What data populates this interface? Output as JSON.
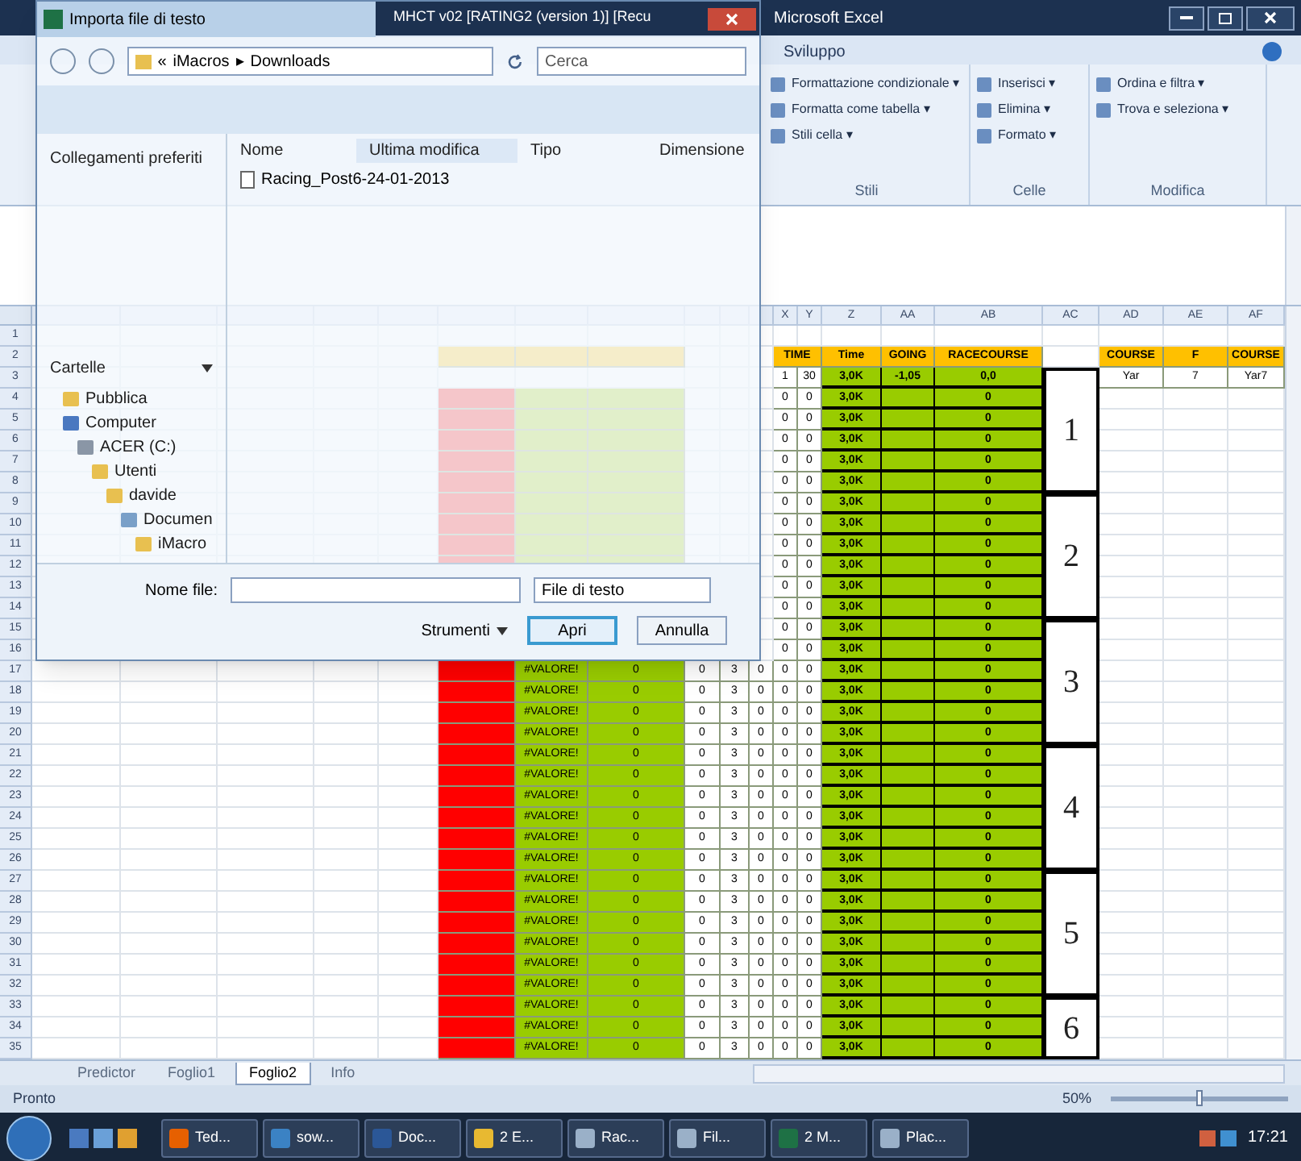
{
  "excel": {
    "title_parts": [
      "MHCT v02 [RATING2 (version 1)] [Recu",
      "Microsoft Excel"
    ],
    "ribbon_tabs": [
      {
        "label": "Sviluppo",
        "selected": false
      }
    ],
    "ribbon_groups": [
      {
        "label": "Stili",
        "items": [
          "Formattazione condizionale ▾",
          "Formatta come tabella ▾",
          "Stili cella ▾"
        ]
      },
      {
        "label": "Celle",
        "items": [
          "Inserisci ▾",
          "Elimina ▾",
          "Formato ▾"
        ]
      },
      {
        "label": "Modifica",
        "items": [
          "Ordina e filtra ▾",
          "Trova e seleziona ▾"
        ]
      }
    ],
    "sheet": {
      "columns": [
        "X",
        "Y",
        "Z",
        "AA",
        "AB",
        "AC",
        "AD",
        "AE",
        "AF"
      ],
      "races": [
        "1",
        "2",
        "3",
        "4",
        "5",
        "6"
      ],
      "rows": [
        {
          "number": "1",
          "kind": "blank"
        },
        {
          "number": "2",
          "kind": "header",
          "time_1": "TIME",
          "time": "Time",
          "going": "GOING",
          "racecourse": "RACECOURSE",
          "course": "COURSE",
          "f": "F",
          "course_2": "COURSE"
        },
        {
          "number": "3",
          "kind": "lead",
          "time_1": "1",
          "time_2": "30",
          "time": "3,0K",
          "going": "-1,05",
          "racecourse": "0,0",
          "course": "Yar",
          "f": "7",
          "course_2": "Yar7"
        },
        {
          "number": "4",
          "kind": "data",
          "time_1": "0",
          "time_2": "0",
          "time": "3,0K",
          "racecourse": "0"
        },
        {
          "number": "5",
          "kind": "data",
          "time_1": "0",
          "time_2": "0",
          "time": "3,0K",
          "racecourse": "0"
        },
        {
          "number": "6",
          "kind": "data",
          "time_1": "0",
          "time_2": "0",
          "time": "3,0K",
          "racecourse": "0"
        },
        {
          "number": "7",
          "kind": "data",
          "time_1": "0",
          "time_2": "0",
          "time": "3,0K",
          "racecourse": "0"
        },
        {
          "number": "8",
          "kind": "data",
          "time_1": "0",
          "time_2": "0",
          "time": "3,0K",
          "racecourse": "0"
        },
        {
          "number": "9",
          "kind": "data",
          "time_1": "0",
          "time_2": "0",
          "time": "3,0K",
          "racecourse": "0"
        },
        {
          "number": "10",
          "kind": "data",
          "time_1": "0",
          "time_2": "0",
          "time": "3,0K",
          "racecourse": "0"
        },
        {
          "number": "11",
          "kind": "data",
          "time_1": "0",
          "time_2": "0",
          "time": "3,0K",
          "racecourse": "0"
        },
        {
          "number": "12",
          "kind": "data",
          "time_1": "0",
          "time_2": "0",
          "time": "3,0K",
          "racecourse": "0"
        },
        {
          "number": "13",
          "kind": "data",
          "time_1": "0",
          "time_2": "0",
          "time": "3,0K",
          "racecourse": "0"
        },
        {
          "number": "14",
          "kind": "data",
          "time_1": "0",
          "time_2": "0",
          "time": "3,0K",
          "racecourse": "0"
        },
        {
          "number": "15",
          "kind": "data",
          "time_1": "0",
          "time_2": "0",
          "time": "3,0K",
          "racecourse": "0"
        },
        {
          "number": "16",
          "kind": "data",
          "time_1": "0",
          "time_2": "0",
          "time": "3,0K",
          "racecourse": "0"
        },
        {
          "number": "17",
          "kind": "data",
          "ottimale": "#VALORE!",
          "yard": "0",
          "col_i": "0",
          "col_j": "3",
          "col_w": "0",
          "time_1": "0",
          "time_2": "0",
          "time": "3,0K",
          "racecourse": "0"
        },
        {
          "number": "18",
          "kind": "data",
          "ottimale": "#VALORE!",
          "yard": "0",
          "col_i": "0",
          "col_j": "3",
          "col_w": "0",
          "time_1": "0",
          "time_2": "0",
          "time": "3,0K",
          "racecourse": "0"
        },
        {
          "number": "19",
          "kind": "data",
          "ottimale": "#VALORE!",
          "yard": "0",
          "col_i": "0",
          "col_j": "3",
          "col_w": "0",
          "time_1": "0",
          "time_2": "0",
          "time": "3,0K",
          "racecourse": "0"
        },
        {
          "number": "20",
          "kind": "data",
          "ottimale": "#VALORE!",
          "yard": "0",
          "col_i": "0",
          "col_j": "3",
          "col_w": "0",
          "time_1": "0",
          "time_2": "0",
          "time": "3,0K",
          "racecourse": "0"
        },
        {
          "number": "21",
          "kind": "data",
          "ottimale": "#VALORE!",
          "yard": "0",
          "col_i": "0",
          "col_j": "3",
          "col_w": "0",
          "time_1": "0",
          "time_2": "0",
          "time": "3,0K",
          "racecourse": "0"
        },
        {
          "number": "22",
          "kind": "data",
          "ottimale": "#VALORE!",
          "yard": "0",
          "col_i": "0",
          "col_j": "3",
          "col_w": "0",
          "time_1": "0",
          "time_2": "0",
          "time": "3,0K",
          "racecourse": "0"
        },
        {
          "number": "23",
          "kind": "data",
          "ottimale": "#VALORE!",
          "yard": "0",
          "col_i": "0",
          "col_j": "3",
          "col_w": "0",
          "time_1": "0",
          "time_2": "0",
          "time": "3,0K",
          "racecourse": "0"
        },
        {
          "number": "24",
          "kind": "data",
          "ottimale": "#VALORE!",
          "yard": "0",
          "col_i": "0",
          "col_j": "3",
          "col_w": "0",
          "time_1": "0",
          "time_2": "0",
          "time": "3,0K",
          "racecourse": "0"
        },
        {
          "number": "25",
          "kind": "data",
          "ottimale": "#VALORE!",
          "yard": "0",
          "col_i": "0",
          "col_j": "3",
          "col_w": "0",
          "time_1": "0",
          "time_2": "0",
          "time": "3,0K",
          "racecourse": "0"
        },
        {
          "number": "26",
          "kind": "data",
          "ottimale": "#VALORE!",
          "yard": "0",
          "col_i": "0",
          "col_j": "3",
          "col_w": "0",
          "time_1": "0",
          "time_2": "0",
          "time": "3,0K",
          "racecourse": "0"
        },
        {
          "number": "27",
          "kind": "data",
          "ottimale": "#VALORE!",
          "yard": "0",
          "col_i": "0",
          "col_j": "3",
          "col_w": "0",
          "time_1": "0",
          "time_2": "0",
          "time": "3,0K",
          "racecourse": "0"
        },
        {
          "number": "28",
          "kind": "data",
          "ottimale": "#VALORE!",
          "yard": "0",
          "col_i": "0",
          "col_j": "3",
          "col_w": "0",
          "time_1": "0",
          "time_2": "0",
          "time": "3,0K",
          "racecourse": "0"
        },
        {
          "number": "29",
          "kind": "data",
          "ottimale": "#VALORE!",
          "yard": "0",
          "col_i": "0",
          "col_j": "3",
          "col_w": "0",
          "time_1": "0",
          "time_2": "0",
          "time": "3,0K",
          "racecourse": "0"
        },
        {
          "number": "30",
          "kind": "data",
          "ottimale": "#VALORE!",
          "yard": "0",
          "col_i": "0",
          "col_j": "3",
          "col_w": "0",
          "time_1": "0",
          "time_2": "0",
          "time": "3,0K",
          "racecourse": "0"
        },
        {
          "number": "31",
          "kind": "data",
          "ottimale": "#VALORE!",
          "yard": "0",
          "col_i": "0",
          "col_j": "3",
          "col_w": "0",
          "time_1": "0",
          "time_2": "0",
          "time": "3,0K",
          "racecourse": "0"
        },
        {
          "number": "32",
          "kind": "data",
          "ottimale": "#VALORE!",
          "yard": "0",
          "col_i": "0",
          "col_j": "3",
          "col_w": "0",
          "time_1": "0",
          "time_2": "0",
          "time": "3,0K",
          "racecourse": "0"
        },
        {
          "number": "33",
          "kind": "data",
          "ottimale": "#VALORE!",
          "yard": "0",
          "col_i": "0",
          "col_j": "3",
          "col_w": "0",
          "time_1": "0",
          "time_2": "0",
          "time": "3,0K",
          "racecourse": "0"
        },
        {
          "number": "34",
          "kind": "data",
          "ottimale": "#VALORE!",
          "yard": "0",
          "col_i": "0",
          "col_j": "3",
          "col_w": "0",
          "time_1": "0",
          "time_2": "0",
          "time": "3,0K",
          "racecourse": "0"
        },
        {
          "number": "35",
          "kind": "data",
          "ottimale": "#VALORE!",
          "yard": "0",
          "col_i": "0",
          "col_j": "3",
          "col_w": "0",
          "time_1": "0",
          "time_2": "0",
          "time": "3,0K",
          "racecourse": "0"
        }
      ]
    },
    "sheet_tabs": [
      {
        "label": "Predictor",
        "selected": false
      },
      {
        "label": "Foglio1",
        "selected": false
      },
      {
        "label": "Foglio2",
        "selected": true
      },
      {
        "label": "Info",
        "selected": false
      }
    ],
    "status": "Pronto",
    "zoom": "50%",
    "zoom_slider": {
      "level": 0.5
    }
  },
  "dialog": {
    "title": "Importa file di testo",
    "address": [
      "«",
      "iMacros",
      "▸",
      "Downloads"
    ],
    "search": {
      "placeholder": "Cerca"
    },
    "favorites": "Collegamenti preferiti",
    "folders": "Cartelle",
    "tree": [
      {
        "label": "Pubblica",
        "kind": "folder"
      },
      {
        "label": "Computer",
        "kind": "computer",
        "children": [
          {
            "label": "ACER (C:)",
            "kind": "drive",
            "children": [
              {
                "label": "Utenti",
                "kind": "folder",
                "children": [
                  {
                    "label": "davide",
                    "kind": "folder",
                    "children": [
                      {
                        "label": "Documen",
                        "kind": "library",
                        "children": [
                          {
                            "label": "iMacro",
                            "kind": "folder"
                          }
                        ]
                      }
                    ]
                  }
                ]
              }
            ]
          }
        ]
      }
    ],
    "list_columns": [
      "Nome",
      "Ultima modifica",
      "Tipo",
      "Dimensione"
    ],
    "files": [
      "Racing_Post6-24-01-2013"
    ],
    "file_name_label": "Nome file:",
    "file_type": "File di testo",
    "tools": "Strumenti",
    "open": "Apri",
    "cancel": "Annulla"
  },
  "taskbar": {
    "items": [
      {
        "label": "Ted...",
        "kind": "browser"
      },
      {
        "label": "sow...",
        "kind": "globe"
      },
      {
        "label": "Doc...",
        "kind": "word"
      },
      {
        "label": "2 E...",
        "kind": "folder"
      },
      {
        "label": "Rac...",
        "kind": "doc"
      },
      {
        "label": "Fil...",
        "kind": "doc"
      },
      {
        "label": "2 M...",
        "kind": "excel"
      },
      {
        "label": "Plac...",
        "kind": "doc"
      }
    ],
    "clock": "17:21"
  }
}
